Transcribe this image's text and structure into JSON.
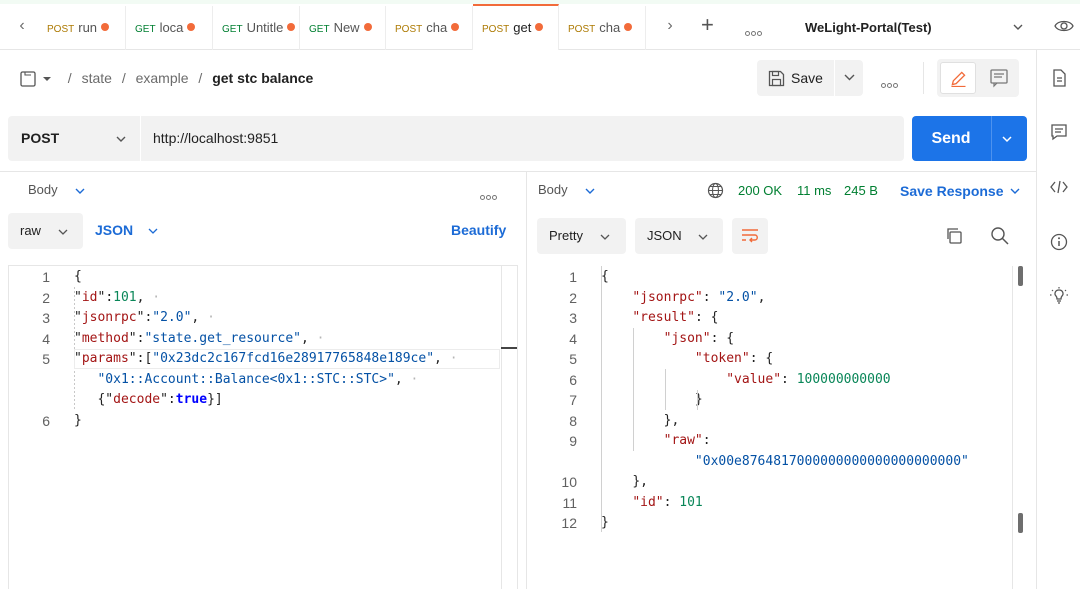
{
  "tabs": [
    {
      "method": "POST",
      "title": "run",
      "active": false
    },
    {
      "method": "GET",
      "title": "loca",
      "active": false
    },
    {
      "method": "GET",
      "title": "Untitle",
      "active": false
    },
    {
      "method": "GET",
      "title": "New",
      "active": false
    },
    {
      "method": "POST",
      "title": "cha",
      "active": false
    },
    {
      "method": "POST",
      "title": "get",
      "active": true
    },
    {
      "method": "POST",
      "title": "cha",
      "active": false
    }
  ],
  "environment": {
    "name": "WeLight-Portal(Test)"
  },
  "breadcrumb": {
    "items": [
      "state",
      "example"
    ],
    "current": "get stc balance",
    "separator": "/"
  },
  "toolbar": {
    "save_label": "Save"
  },
  "request": {
    "method": "POST",
    "url": "http://localhost:9851",
    "send_label": "Send",
    "body_tab": "Body",
    "body_type": "raw",
    "format": "JSON",
    "beautify_label": "Beautify",
    "body_lines": [
      {
        "n": "1",
        "segs": [
          [
            "pun",
            "{"
          ]
        ]
      },
      {
        "n": "2",
        "segs": [
          [
            "pun",
            "\""
          ],
          [
            "key",
            "id"
          ],
          [
            "pun",
            "\""
          ],
          [
            "pun",
            ":"
          ],
          [
            "num",
            "101"
          ],
          [
            "pun",
            ","
          ],
          [
            "ws",
            " ·"
          ]
        ]
      },
      {
        "n": "3",
        "segs": [
          [
            "pun",
            "\""
          ],
          [
            "key",
            "jsonrpc"
          ],
          [
            "pun",
            "\":"
          ],
          [
            "str",
            "\"2.0\""
          ],
          [
            "pun",
            ","
          ],
          [
            "ws",
            " ·"
          ]
        ]
      },
      {
        "n": "4",
        "segs": [
          [
            "pun",
            "\""
          ],
          [
            "key",
            "method"
          ],
          [
            "pun",
            "\":"
          ],
          [
            "str",
            "\"state.get_resource\""
          ],
          [
            "pun",
            ","
          ],
          [
            "ws",
            " ·"
          ]
        ]
      },
      {
        "n": "5",
        "segs": [
          [
            "pun",
            "\""
          ],
          [
            "key",
            "params"
          ],
          [
            "pun",
            "\":["
          ],
          [
            "str",
            "\"0x23dc2c167fcd16e28917765848e189ce\""
          ],
          [
            "pun",
            ","
          ],
          [
            "ws",
            " ·"
          ]
        ]
      },
      {
        "n": "",
        "segs": [
          [
            "ws",
            "   "
          ],
          [
            "str",
            "\"0x1::Account::Balance<0x1::STC::STC>\""
          ],
          [
            "pun",
            ","
          ],
          [
            "ws",
            " ·"
          ]
        ]
      },
      {
        "n": "",
        "segs": [
          [
            "ws",
            "   "
          ],
          [
            "pun",
            "{\""
          ],
          [
            "key",
            "decode"
          ],
          [
            "pun",
            "\":"
          ],
          [
            "kw",
            "true"
          ],
          [
            "pun",
            "}]"
          ]
        ]
      },
      {
        "n": "6",
        "segs": [
          [
            "pun",
            "}"
          ]
        ]
      }
    ]
  },
  "response": {
    "body_tab": "Body",
    "status": "200 OK",
    "time": "11 ms",
    "size": "245 B",
    "save_label": "Save Response",
    "view_mode": "Pretty",
    "format": "JSON",
    "lines": [
      {
        "n": "1",
        "segs": [
          [
            "pun",
            "{"
          ]
        ]
      },
      {
        "n": "2",
        "segs": [
          [
            "ws",
            "    "
          ],
          [
            "key",
            "\"jsonrpc\""
          ],
          [
            "pun",
            ": "
          ],
          [
            "str",
            "\"2.0\""
          ],
          [
            "pun",
            ","
          ]
        ]
      },
      {
        "n": "3",
        "segs": [
          [
            "ws",
            "    "
          ],
          [
            "key",
            "\"result\""
          ],
          [
            "pun",
            ": {"
          ]
        ]
      },
      {
        "n": "4",
        "segs": [
          [
            "ws",
            "        "
          ],
          [
            "key",
            "\"json\""
          ],
          [
            "pun",
            ": {"
          ]
        ]
      },
      {
        "n": "5",
        "segs": [
          [
            "ws",
            "            "
          ],
          [
            "key",
            "\"token\""
          ],
          [
            "pun",
            ": {"
          ]
        ]
      },
      {
        "n": "6",
        "segs": [
          [
            "ws",
            "                "
          ],
          [
            "key",
            "\"value\""
          ],
          [
            "pun",
            ": "
          ],
          [
            "num",
            "100000000000"
          ]
        ]
      },
      {
        "n": "7",
        "segs": [
          [
            "ws",
            "            "
          ],
          [
            "pun",
            "}"
          ]
        ]
      },
      {
        "n": "8",
        "segs": [
          [
            "ws",
            "        "
          ],
          [
            "pun",
            "},"
          ]
        ]
      },
      {
        "n": "9",
        "segs": [
          [
            "ws",
            "        "
          ],
          [
            "key",
            "\"raw\""
          ],
          [
            "pun",
            ":"
          ]
        ]
      },
      {
        "n": "",
        "segs": [
          [
            "ws",
            "            "
          ],
          [
            "str",
            "\"0x00e8764817000000000000000000000\""
          ]
        ]
      },
      {
        "n": "10",
        "segs": [
          [
            "ws",
            "    "
          ],
          [
            "pun",
            "},"
          ]
        ]
      },
      {
        "n": "11",
        "segs": [
          [
            "ws",
            "    "
          ],
          [
            "key",
            "\"id\""
          ],
          [
            "pun",
            ": "
          ],
          [
            "num",
            "101"
          ]
        ]
      },
      {
        "n": "12",
        "segs": [
          [
            "pun",
            "}"
          ]
        ]
      }
    ]
  }
}
